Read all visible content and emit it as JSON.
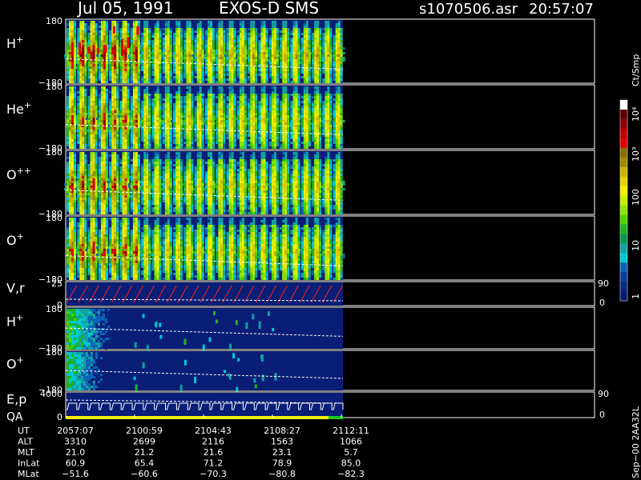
{
  "header": {
    "date": "Jul 05, 1991",
    "instrument": "EXOS-D SMS",
    "file": "s1070506.asr",
    "time": "20:57:07"
  },
  "colorbar": {
    "title": "Ct/Smp",
    "tick_labels": [
      "10⁴",
      "10³",
      "100",
      "10",
      "1"
    ],
    "colors": [
      "#ffffff",
      "#5a0000",
      "#8b0000",
      "#c00000",
      "#e00000",
      "#8b6e00",
      "#a08a00",
      "#c8b400",
      "#e6d200",
      "#f5f000",
      "#c8f000",
      "#8ce600",
      "#50d200",
      "#1eb41e",
      "#0a9650",
      "#14a0a0",
      "#00c8d2",
      "#0a64b4",
      "#0a3c9b",
      "#0a2882",
      "#081c6e"
    ]
  },
  "chart_data": {
    "type": "heatmap",
    "panels": [
      {
        "id": "p1",
        "label": "H",
        "sup": "+",
        "ytop": "180",
        "ybottom": "−180"
      },
      {
        "id": "p2",
        "label": "He",
        "sup": "+",
        "ytop": "180",
        "ybottom": "−180"
      },
      {
        "id": "p3",
        "label": "O",
        "sup": "++",
        "ytop": "180",
        "ybottom": "−180"
      },
      {
        "id": "p4",
        "label": "O",
        "sup": "+",
        "ytop": "180",
        "ybottom": "−180"
      },
      {
        "id": "p5",
        "label": "V,r",
        "sup": "",
        "ytop": "25",
        "ybottom": "0",
        "right_top": "90",
        "right_bottom": "0"
      },
      {
        "id": "p6",
        "label": "H",
        "sup": "+",
        "ytop": "180",
        "ybottom": "−180"
      },
      {
        "id": "p7",
        "label": "O",
        "sup": "+",
        "ytop": "180",
        "ybottom": "−180"
      },
      {
        "id": "p8",
        "label": "E,p",
        "label2": "QA",
        "sup": "",
        "ytop": "4000",
        "ybottom": "0",
        "right_top": "90",
        "right_bottom": "0"
      }
    ],
    "x_ticks": [
      "2057:07",
      "2100:59",
      "2104:43",
      "2108:27",
      "2112:11"
    ],
    "rows": [
      {
        "name": "UT",
        "values": [
          "2057:07",
          "2100:59",
          "2104:43",
          "2108:27",
          "2112:11"
        ]
      },
      {
        "name": "ALT",
        "values": [
          "3310",
          "2699",
          "2116",
          "1563",
          "1066"
        ]
      },
      {
        "name": "MLT",
        "values": [
          "21.0",
          "21.2",
          "21.6",
          "23.1",
          "5.7"
        ]
      },
      {
        "name": "InLat",
        "values": [
          "60.9",
          "65.4",
          "71.2",
          "78.9",
          "85.0"
        ]
      },
      {
        "name": "MLat",
        "values": [
          "−51.6",
          "−60.6",
          "−70.3",
          "−80.8",
          "−82.3"
        ]
      }
    ],
    "right_note": "Sep−00  2AA32L"
  }
}
